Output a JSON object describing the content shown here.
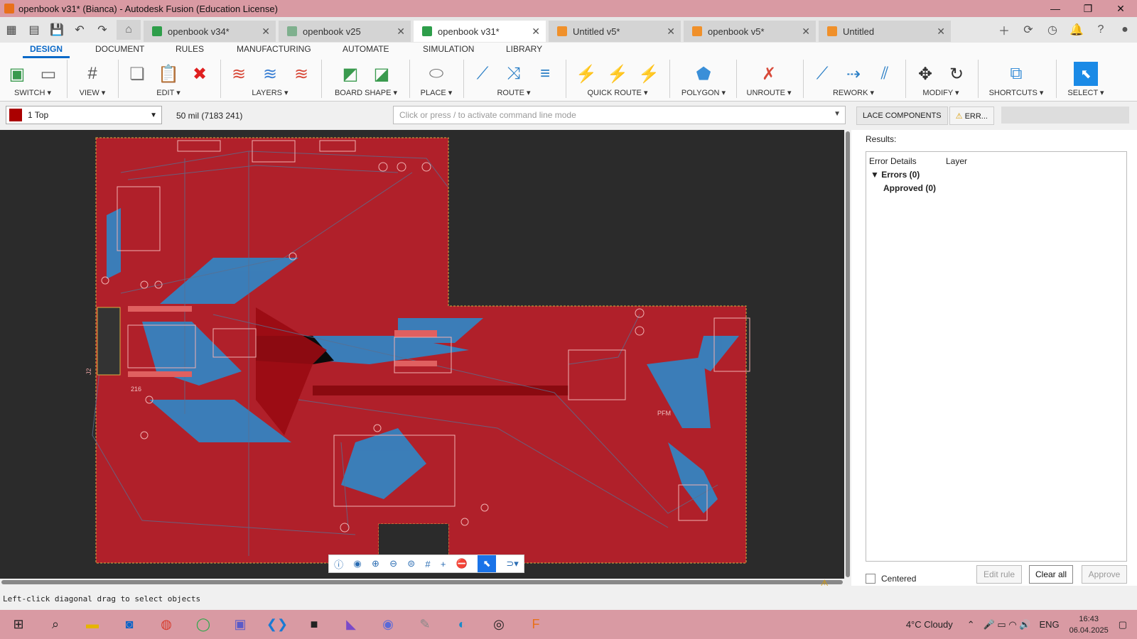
{
  "window": {
    "title": "openbook v31* (Bianca) - Autodesk Fusion (Education License)",
    "min": "—",
    "max": "❐",
    "close": "✕"
  },
  "tabs": [
    {
      "label": "openbook v34*",
      "color": "#2e9e4a"
    },
    {
      "label": "openbook v25",
      "color": "#7fb08e"
    },
    {
      "label": "openbook v31*",
      "color": "#2e9e4a"
    },
    {
      "label": "Untitled v5*",
      "color": "#f0902a"
    },
    {
      "label": "openbook v5*",
      "color": "#f0902a"
    },
    {
      "label": "Untitled",
      "color": "#f0902a"
    }
  ],
  "ribbon_tabs": [
    "DESIGN",
    "DOCUMENT",
    "RULES",
    "MANUFACTURING",
    "AUTOMATE",
    "SIMULATION",
    "LIBRARY"
  ],
  "tool_groups": [
    "SWITCH ▾",
    "VIEW ▾",
    "EDIT ▾",
    "LAYERS ▾",
    "BOARD SHAPE ▾",
    "PLACE ▾",
    "ROUTE ▾",
    "QUICK ROUTE ▾",
    "POLYGON ▾",
    "UNROUTE ▾",
    "REWORK ▾",
    "MODIFY ▾",
    "SHORTCUTS ▾",
    "SELECT ▾"
  ],
  "layer": {
    "name": "1 Top",
    "color": "#a00000"
  },
  "grid_readout": "50 mil (7183 241)",
  "command_line": {
    "placeholder": "Click or press / to activate command line mode"
  },
  "side_tabs": [
    "LACE COMPONENTS",
    "ERR..."
  ],
  "results": {
    "label": "Results:",
    "columns": [
      "Error Details",
      "Layer"
    ],
    "errors": "Errors (0)",
    "approved": "Approved (0)"
  },
  "panel_footer": {
    "centered": "Centered",
    "edit_rule": "Edit rule",
    "clear_all": "Clear all",
    "approve": "Approve"
  },
  "status": "Left-click diagonal drag to select objects",
  "taskbar": {
    "weather": "4°C  Cloudy",
    "lang": "ENG",
    "time": "16:43",
    "date": "06.04.2025"
  },
  "pcb_labels": [
    "J2",
    "216",
    "PFM"
  ]
}
